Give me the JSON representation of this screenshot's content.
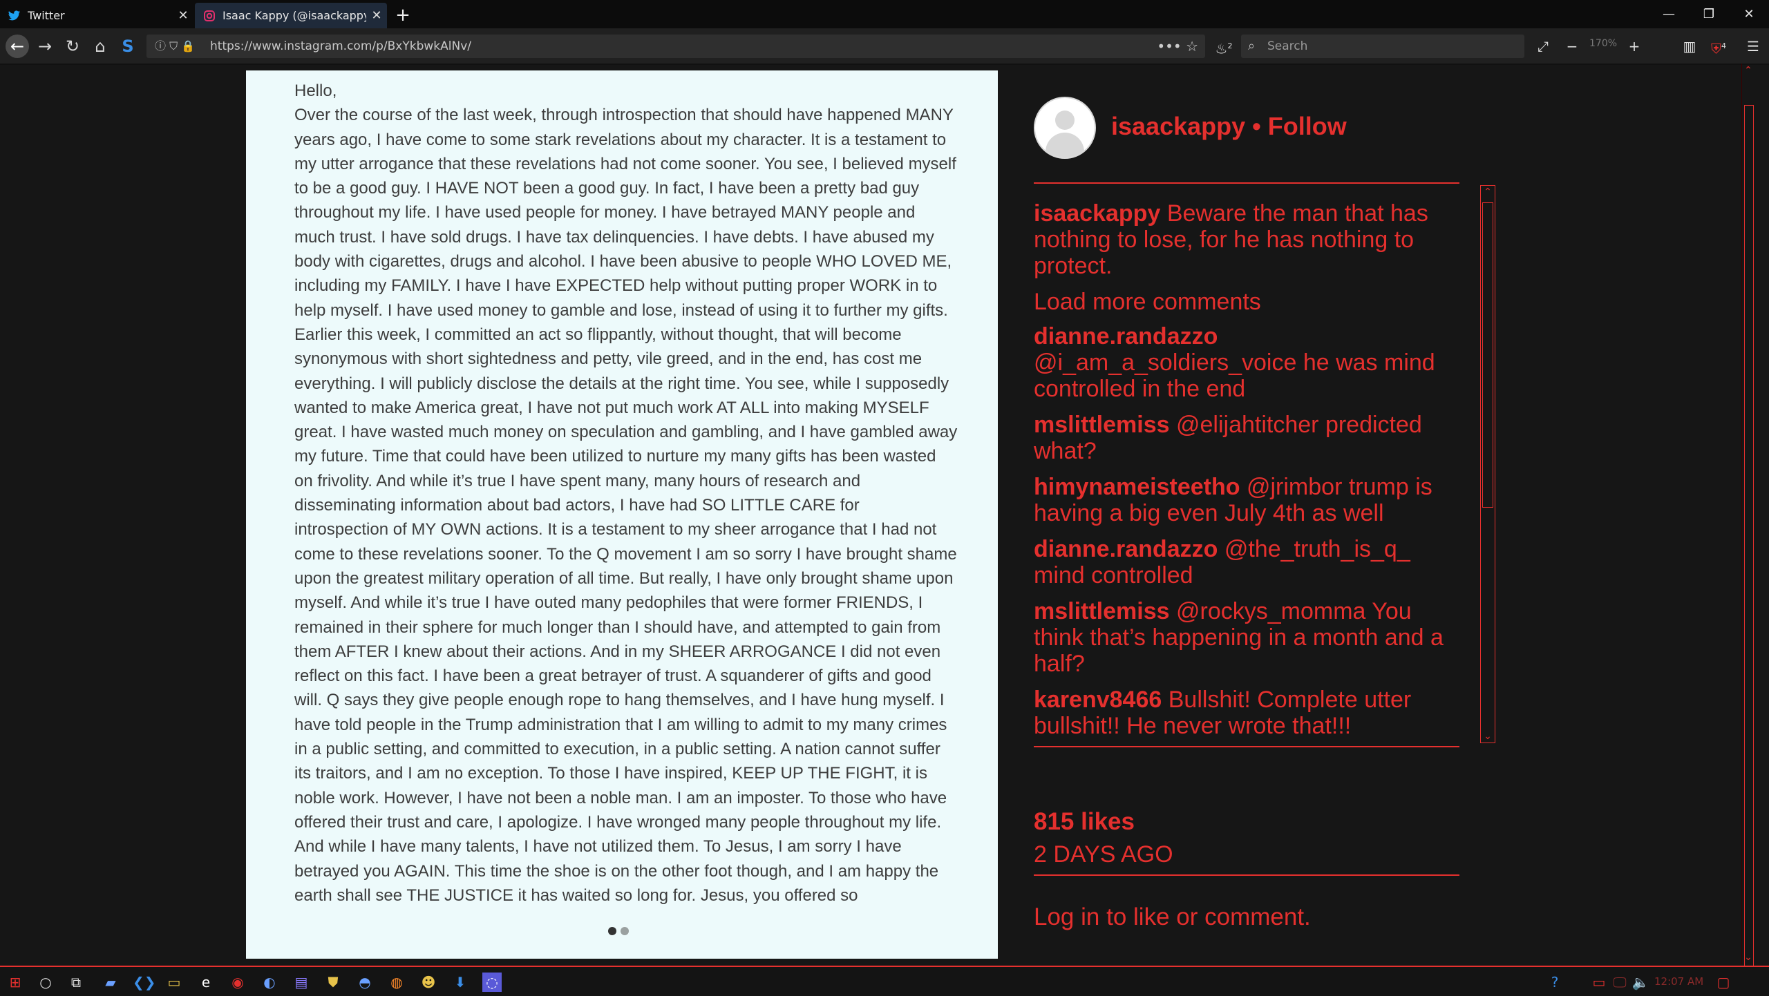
{
  "browser": {
    "tabs": [
      {
        "label": "Twitter",
        "icon": "twitter-icon"
      },
      {
        "label": "Isaac Kappy (@isaackappy) • In",
        "icon": "instagram-icon"
      }
    ],
    "url": "https://www.instagram.com/p/BxYkbwkAlNv/",
    "search_placeholder": "Search",
    "zoom": "170%",
    "badge_count": "2",
    "ext_count": "4"
  },
  "post": {
    "paragraphs": [
      "Hello,",
      "Over the course of the last week, through introspection that should have happened MANY years ago, I have come to some stark revelations about my character. It is a testament to my utter arrogance that these revelations had not come sooner. You see, I believed myself to be a good guy. I HAVE NOT been a good guy. In fact, I have been a pretty bad guy throughout my life. I have used people for money. I have betrayed MANY people and much trust. I have sold drugs. I have tax delinquencies. I have debts. I have abused my body with cigarettes, drugs and alcohol. I have been abusive to people WHO LOVED ME, including my FAMILY. I have I have EXPECTED help without putting proper WORK in to help myself. I have used money to gamble and lose, instead of using it to further my gifts. Earlier this week, I committed an act so flippantly, without thought, that will become synonymous with short sightedness and petty, vile greed, and in the end, has cost me everything. I will publicly disclose the details at the right time. You see, while I supposedly wanted to make America great, I have not put much work AT ALL into making MYSELF great. I have wasted much money on speculation and gambling, and I have gambled away my future. Time that could have been utilized to nurture my many gifts has been wasted on frivolity. And while it’s true I have spent many, many hours of research and disseminating information about bad actors, I have had SO LITTLE CARE for introspection of MY OWN actions. It is a testament to my sheer arrogance that I had not come to these revelations sooner. To the Q movement I am so sorry I have brought shame upon the greatest military operation of all time. But really, I have only brought shame upon myself. And while it’s true I have outed many pedophiles that were former FRIENDS, I remained in their sphere for much longer than I should have, and attempted to gain from them AFTER I knew about their actions. And in my SHEER ARROGANCE I did not even reflect on this fact. I have been a great betrayer of trust. A squanderer of gifts and good will. Q says they give people enough rope to hang themselves, and I have hung myself. I have told people in the Trump administration that I am willing to admit to my many crimes in a public setting, and committed to execution, in a public setting. A nation cannot suffer its traitors, and I am no exception. To those I have inspired, KEEP UP THE FIGHT, it is noble work. However, I have not been a noble man. I am an imposter. To those who have offered their trust and care, I apologize. I have wronged many people throughout my life. And while I have many talents, I have not utilized them. To Jesus, I am sorry I have betrayed you AGAIN. This time the shoe is on the other foot though, and I am happy the earth shall see THE JUSTICE it has waited so long for. Jesus, you offered so"
    ]
  },
  "sidebar": {
    "username": "isaackappy",
    "follow_text": "isaackappy • Follow",
    "caption_user": "isaackappy",
    "caption_text": "Beware the man that has nothing to lose, for he has nothing to protect.",
    "load_more": "Load more comments",
    "comments": [
      {
        "user": "dianne.randazzo",
        "mention": "@i_am_a_soldiers_voice",
        "text": "he was mind controlled in the end"
      },
      {
        "user": "mslittlemiss",
        "mention": "@elijahtitcher",
        "text": "predicted what?"
      },
      {
        "user": "himynameisteetho",
        "mention": "@jrimbor",
        "text": "trump is having a big even July 4th as well"
      },
      {
        "user": "dianne.randazzo",
        "mention": "@the_truth_is_q_",
        "text": "mind controlled"
      },
      {
        "user": "mslittlemiss",
        "mention": "@rockys_momma",
        "text": "You think that’s happening in a month and a half?"
      },
      {
        "user": "karenv8466",
        "mention": "",
        "text": "Bullshit! Complete utter bullshit!! He never wrote that!!!"
      }
    ],
    "likes": "815 likes",
    "time_ago": "2 DAYS AGO",
    "login_link": "Log in",
    "login_rest": "to like or comment."
  },
  "taskbar": {
    "clock": "12:07 AM"
  },
  "colors": {
    "accent": "#e5302e",
    "page_bg": "#161616",
    "post_bg": "#edfafb"
  }
}
